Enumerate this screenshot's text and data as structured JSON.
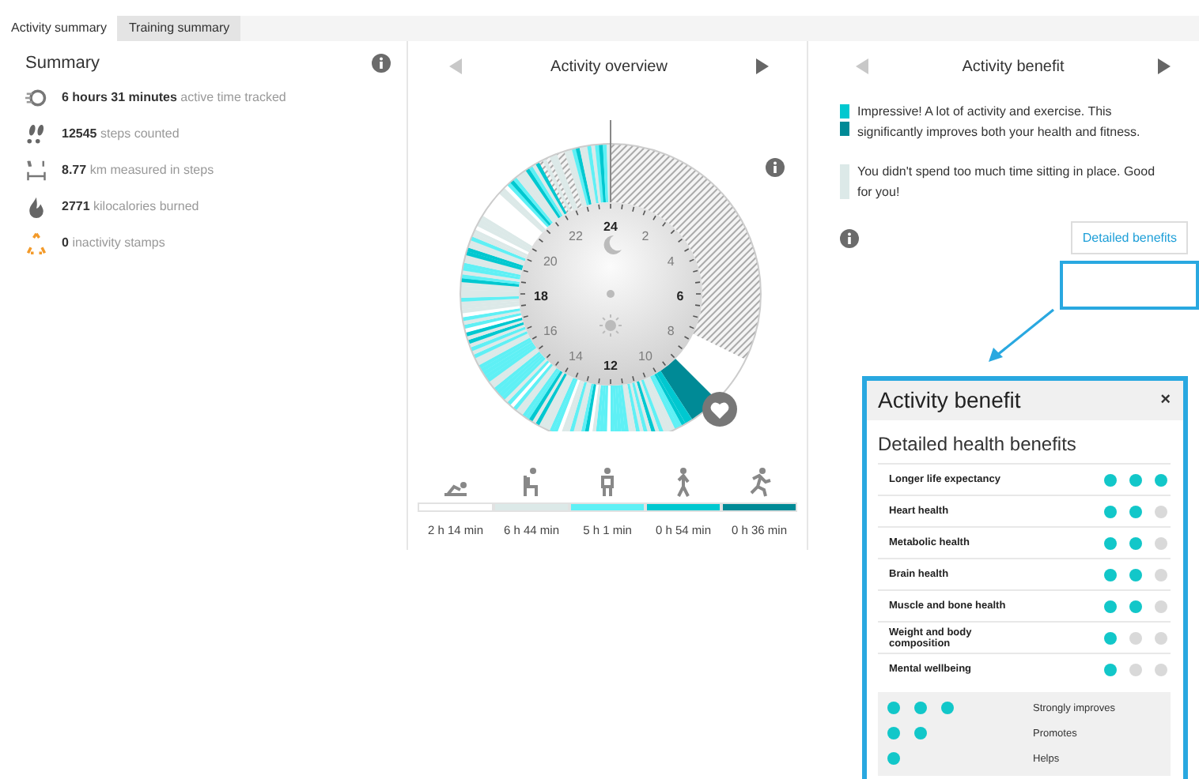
{
  "tabs": [
    {
      "label": "Activity summary",
      "selected": true
    },
    {
      "label": "Training summary",
      "selected": false
    }
  ],
  "summary": {
    "title": "Summary",
    "items": [
      {
        "kind": "active",
        "value": "6 hours 31 minutes",
        "label": "active time tracked"
      },
      {
        "kind": "steps",
        "value": "12545",
        "label": "steps counted"
      },
      {
        "kind": "distance",
        "value": "8.77",
        "label": "km measured in steps"
      },
      {
        "kind": "calories",
        "value": "2771",
        "label": "kilocalories burned"
      },
      {
        "kind": "inactivity",
        "value": "0",
        "label": "inactivity stamps"
      }
    ]
  },
  "overview": {
    "title": "Activity overview",
    "hours": [
      {
        "label": "24",
        "bold": true
      },
      {
        "label": "2",
        "bold": false
      },
      {
        "label": "4",
        "bold": false
      },
      {
        "label": "6",
        "bold": true
      },
      {
        "label": "8",
        "bold": false
      },
      {
        "label": "10",
        "bold": false
      },
      {
        "label": "12",
        "bold": true
      },
      {
        "label": "14",
        "bold": false
      },
      {
        "label": "16",
        "bold": false
      },
      {
        "label": "18",
        "bold": true
      },
      {
        "label": "20",
        "bold": false
      },
      {
        "label": "22",
        "bold": false
      }
    ],
    "levels": [
      {
        "kind": "rest",
        "color": "#ffffff",
        "duration": "2 h 14 min"
      },
      {
        "kind": "sit",
        "color": "#dce9e8",
        "duration": "6 h 44 min"
      },
      {
        "kind": "stand",
        "color": "#5ff0f5",
        "duration": "5 h 1 min"
      },
      {
        "kind": "walk",
        "color": "#00c8d0",
        "duration": "0 h 54 min"
      },
      {
        "kind": "run",
        "color": "#008a96",
        "duration": "0 h 36 min"
      }
    ]
  },
  "benefit": {
    "title": "Activity benefit",
    "messages": [
      {
        "markers": [
          {
            "color": "#00c8d0"
          },
          {
            "color": "#008a96"
          }
        ],
        "text": "Impressive! A lot of activity and exercise. This significantly improves both your health and fitness."
      },
      {
        "markers": [
          {
            "color": "#dce9e8"
          }
        ],
        "text": "You didn't spend too much time sitting in place. Good for you!"
      }
    ],
    "button": "Detailed benefits"
  },
  "popup": {
    "title": "Activity benefit",
    "close": "×",
    "subtitle": "Detailed health benefits",
    "rows": [
      {
        "name": "Longer life expectancy",
        "stars": 3
      },
      {
        "name": "Heart health",
        "stars": 2
      },
      {
        "name": "Metabolic health",
        "stars": 2
      },
      {
        "name": "Brain health",
        "stars": 2
      },
      {
        "name": "Muscle and bone health",
        "stars": 2
      },
      {
        "name": "Weight and body composition",
        "stars": 1
      },
      {
        "name": "Mental wellbeing",
        "stars": 1
      }
    ],
    "legend": [
      {
        "kind": "strong",
        "label": "Strongly improves"
      },
      {
        "kind": "medium",
        "label": "Promotes"
      },
      {
        "kind": "mild",
        "label": "Helps"
      }
    ]
  }
}
